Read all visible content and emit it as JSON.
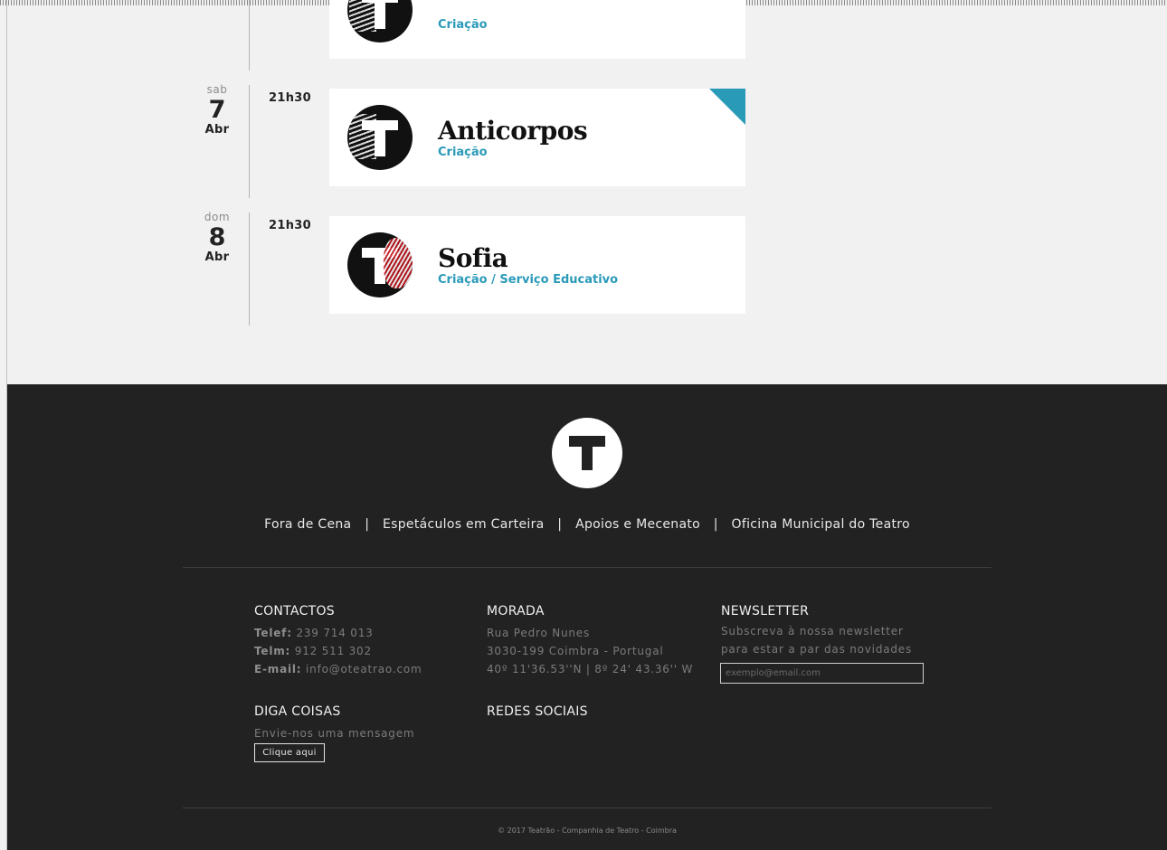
{
  "events": [
    {
      "dow": "",
      "day": "",
      "mon": "",
      "time": "",
      "title": "",
      "category": "Criação"
    },
    {
      "dow": "sab",
      "day": "7",
      "mon": "Abr",
      "time": "21h30",
      "title": "Anticorpos",
      "category": "Criação"
    },
    {
      "dow": "dom",
      "day": "8",
      "mon": "Abr",
      "time": "21h30",
      "title": "Sofia",
      "category": "Criação / Serviço Educativo"
    }
  ],
  "footer": {
    "nav": [
      "Fora de Cena",
      "Espetáculos em Carteira",
      "Apoios e Mecenato",
      "Oficina Municipal do Teatro"
    ],
    "nav_separator": "|",
    "contactos": {
      "heading": "CONTACTOS",
      "telef_label": "Telef:",
      "telef": "239 714 013",
      "telm_label": "Telm:",
      "telm": "912 511 302",
      "email_label": "E-mail:",
      "email": "info@oteatrao.com"
    },
    "morada": {
      "heading": "MORADA",
      "line1": "Rua Pedro Nunes",
      "line2": "3030-199 Coimbra - Portugal",
      "line3": "40º 11'36.53''N | 8º 24' 43.36'' W"
    },
    "newsletter": {
      "heading": "NEWSLETTER",
      "line1": "Subscreva à nossa newsletter",
      "line2": "para estar a par das novidades",
      "placeholder": "exemplo@email.com"
    },
    "diga": {
      "heading": "DIGA COISAS",
      "text": "Envie-nos uma mensagem",
      "button": "Clique aqui"
    },
    "redes": {
      "heading": "REDES SOCIAIS"
    },
    "copyright": "© 2017 Teatrão - Companhia de Teatro - Coimbra"
  },
  "colors": {
    "accent": "#2a9ab9",
    "footer_bg": "#222222",
    "page_bg": "#f1f1f1"
  }
}
